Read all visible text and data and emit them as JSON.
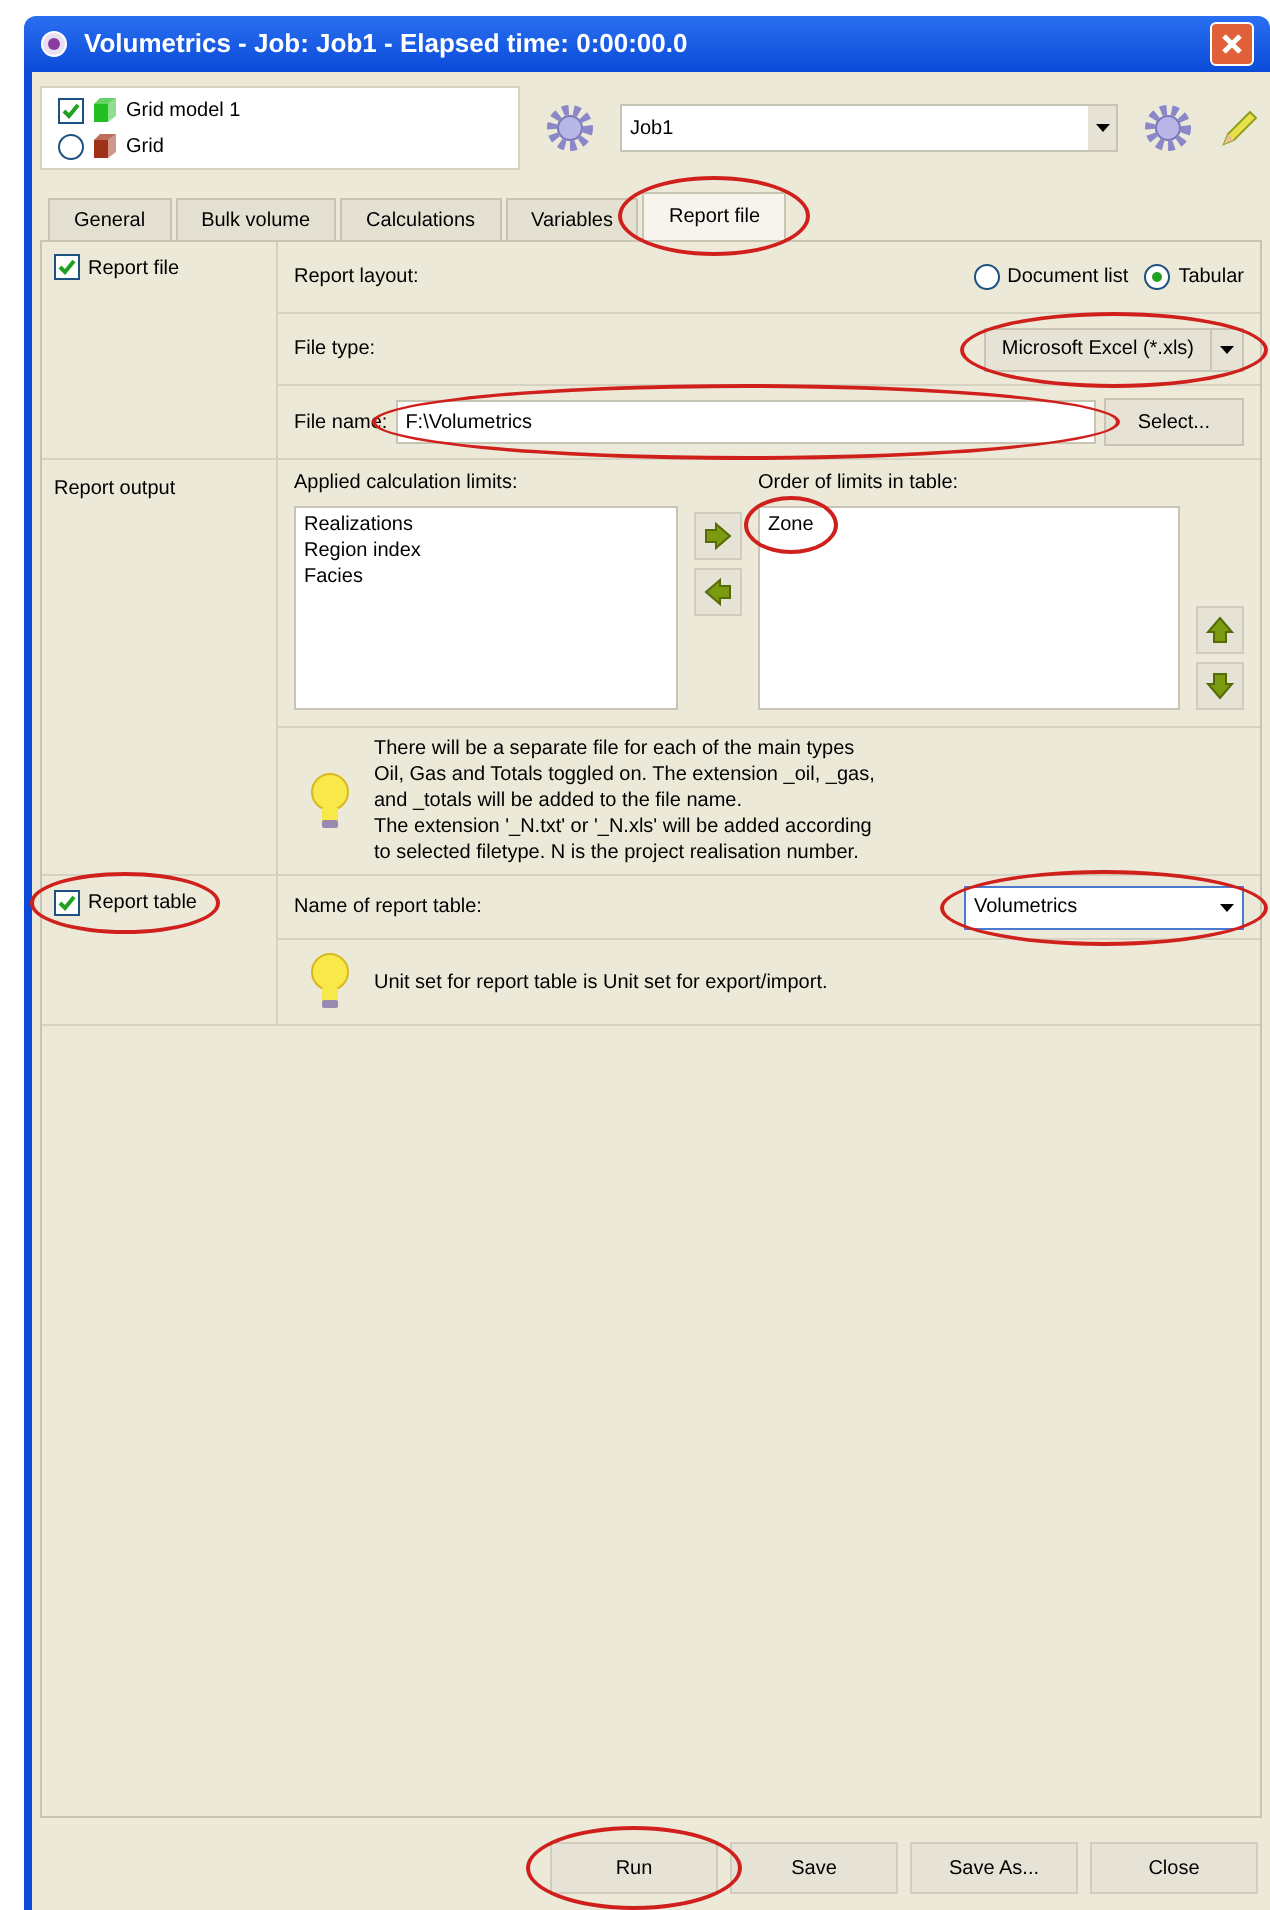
{
  "window": {
    "title": "Volumetrics - Job: Job1 - Elapsed time: 0:00:00.0"
  },
  "models": [
    {
      "label": "Grid model 1",
      "kind": "checkbox",
      "checked": true
    },
    {
      "label": "Grid",
      "kind": "radio",
      "checked": false
    }
  ],
  "job": {
    "value": "Job1"
  },
  "tabs": [
    {
      "label": "General",
      "selected": false,
      "highlighted": false
    },
    {
      "label": "Bulk volume",
      "selected": false,
      "highlighted": false
    },
    {
      "label": "Calculations",
      "selected": false,
      "highlighted": false
    },
    {
      "label": "Variables",
      "selected": false,
      "highlighted": false
    },
    {
      "label": "Report file",
      "selected": true,
      "highlighted": true
    }
  ],
  "report_file": {
    "label": "Report file",
    "checked": true,
    "layout_label": "Report layout:",
    "layout_options": [
      {
        "label": "Document list",
        "selected": false
      },
      {
        "label": "Tabular",
        "selected": true
      }
    ],
    "file_type_label": "File type:",
    "file_type": {
      "value": "Microsoft Excel (*.xls)",
      "highlighted": true
    },
    "file_name_label": "File name:",
    "file_name": {
      "value": "F:\\Volumetrics",
      "highlighted": true
    },
    "select_button": "Select..."
  },
  "report_output": {
    "label": "Report output",
    "applied_label": "Applied calculation limits:",
    "applied": [
      "Realizations",
      "Region index",
      "Facies"
    ],
    "order_label": "Order of limits in table:",
    "order": [
      {
        "label": "Zone",
        "highlighted": true
      }
    ],
    "info": "There will be a separate file for each of the main types\nOil, Gas and Totals toggled on. The extension _oil, _gas,\nand _totals will be added to the file name.\nThe extension '_N.txt' or '_N.xls' will be added according\nto selected filetype. N is the project realisation number."
  },
  "report_table": {
    "label": "Report table",
    "checked": true,
    "highlighted": true,
    "name_label": "Name of report table:",
    "name": {
      "value": "Volumetrics",
      "highlighted": true
    },
    "info": "Unit set for report table is Unit set for export/import."
  },
  "buttons": [
    {
      "label": "Run",
      "highlighted": true
    },
    {
      "label": "Save",
      "highlighted": false
    },
    {
      "label": "Save As...",
      "highlighted": false
    },
    {
      "label": "Close",
      "highlighted": false
    }
  ]
}
